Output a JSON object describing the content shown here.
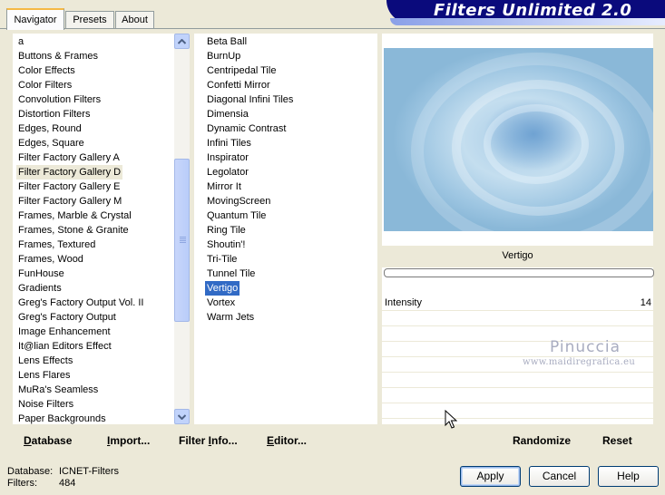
{
  "tabs": [
    {
      "label": "Navigator",
      "active": true
    },
    {
      "label": "Presets",
      "active": false
    },
    {
      "label": "About",
      "active": false
    }
  ],
  "banner": {
    "title": "Filters Unlimited 2.0"
  },
  "categories": {
    "items": [
      "a",
      "Buttons & Frames",
      "Color Effects",
      "Color Filters",
      "Convolution Filters",
      "Distortion Filters",
      "Edges, Round",
      "Edges, Square",
      "Filter Factory Gallery A",
      "Filter Factory Gallery D",
      "Filter Factory Gallery E",
      "Filter Factory Gallery M",
      "Frames, Marble & Crystal",
      "Frames, Stone & Granite",
      "Frames, Textured",
      "Frames, Wood",
      "FunHouse",
      "Gradients",
      "Greg's Factory Output Vol. II",
      "Greg's Factory Output",
      "Image Enhancement",
      "It@lian Editors Effect",
      "Lens Effects",
      "Lens Flares",
      "MuRa's Seamless",
      "Noise Filters",
      "Paper Backgrounds"
    ],
    "selected_index": 9
  },
  "filters": {
    "items": [
      "Beta Ball",
      "BurnUp",
      "Centripedal Tile",
      "Confetti Mirror",
      "Diagonal Infini Tiles",
      "Dimensia",
      "Dynamic Contrast",
      "Infini Tiles",
      "Inspirator",
      "Legolator",
      "Mirror It",
      "MovingScreen",
      "Quantum Tile",
      "Ring Tile",
      "Shoutin'!",
      "Tri-Tile",
      "Tunnel Tile",
      "Vertigo",
      "Vortex",
      "Warm Jets"
    ],
    "selected_index": 17
  },
  "preview": {
    "filter_name": "Vertigo",
    "progress": 0
  },
  "params": [
    {
      "label": "Intensity",
      "value": "14"
    }
  ],
  "watermark": {
    "name": "Pinuccia",
    "url": "www.maidiregrafica.eu"
  },
  "toolbar_left": {
    "database": {
      "u": "D",
      "rest": "atabase"
    },
    "import": {
      "u": "I",
      "rest": "mport..."
    },
    "filter_info": {
      "pre": "Filter ",
      "u": "I",
      "rest": "nfo..."
    },
    "editor": {
      "u": "E",
      "rest": "ditor..."
    }
  },
  "toolbar_right": {
    "randomize": "Randomize",
    "reset": "Reset"
  },
  "status": {
    "database_label": "Database:",
    "database_value": "ICNET-Filters",
    "filters_label": "Filters:",
    "filters_value": "484"
  },
  "buttons": {
    "apply": "Apply",
    "cancel": "Cancel",
    "help": "Help"
  },
  "colors": {
    "selection": "#316ac5",
    "banner": "#0a0a7c",
    "dialog": "#ece9d8"
  }
}
